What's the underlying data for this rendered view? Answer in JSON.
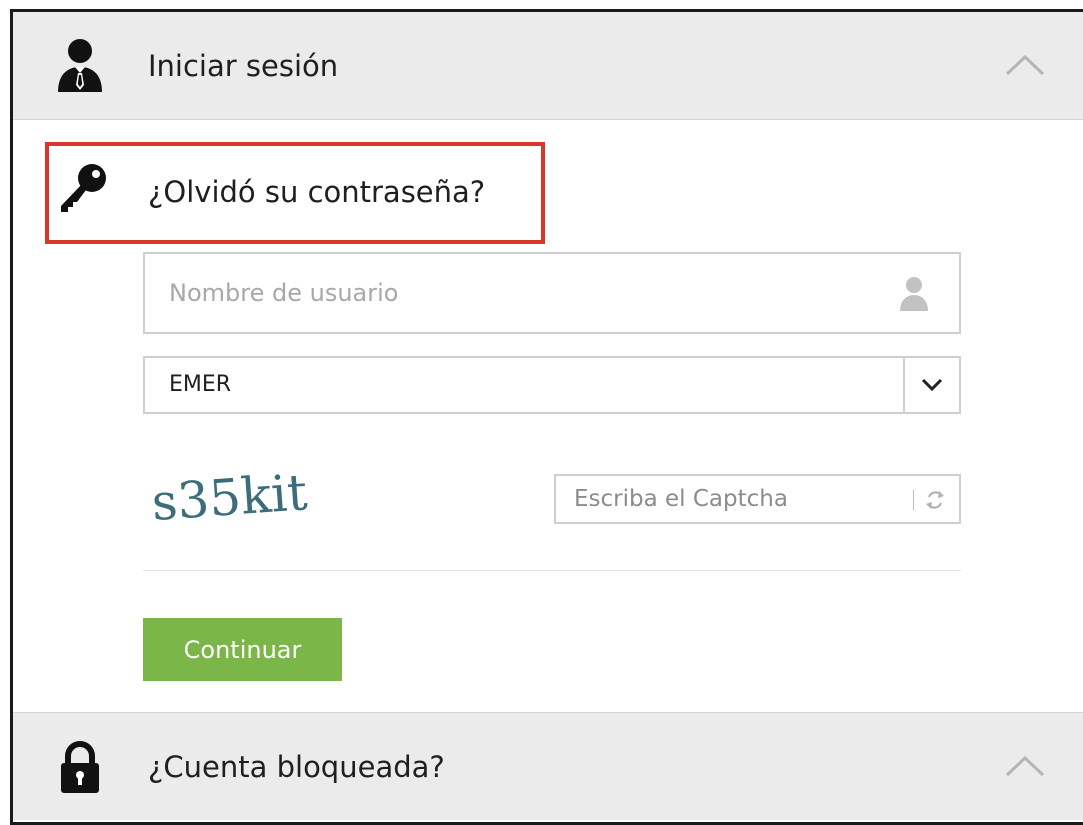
{
  "login_section": {
    "title": "Iniciar sesión",
    "icon": "user-tie-icon"
  },
  "forgot_password": {
    "title": "¿Olvidó su contraseña?",
    "icon": "key-icon",
    "highlight_color": "#d9372b",
    "username": {
      "placeholder": "Nombre de usuario",
      "value": ""
    },
    "domain": {
      "selected": "EMER"
    },
    "captcha": {
      "image_text": "s35kit",
      "placeholder": "Escriba el Captcha"
    },
    "continue_label": "Continuar",
    "button_color": "#7ab648"
  },
  "locked_section": {
    "title": "¿Cuenta bloqueada?",
    "icon": "lock-icon"
  }
}
